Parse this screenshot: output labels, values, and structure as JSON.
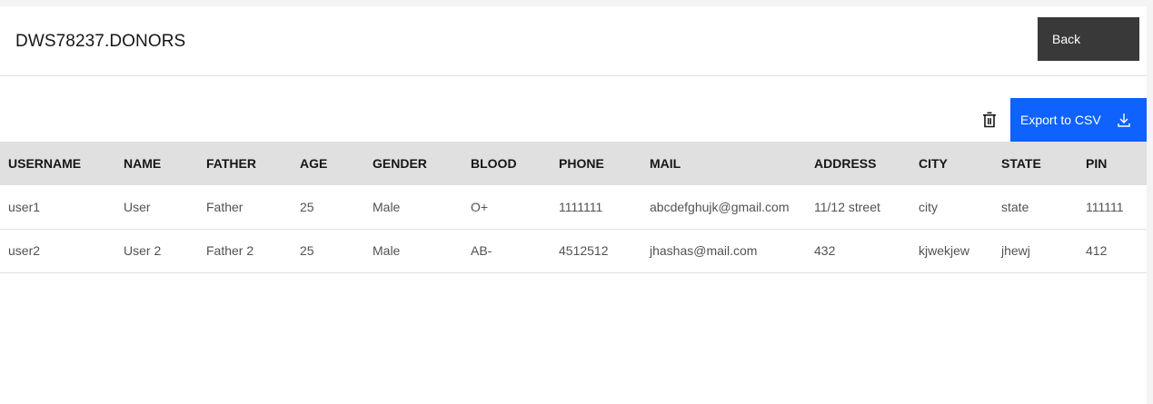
{
  "header": {
    "title": "DWS78237.DONORS",
    "back_label": "Back"
  },
  "toolbar": {
    "delete_icon": "trash-icon",
    "export_label": "Export to CSV",
    "export_icon": "download-icon"
  },
  "colors": {
    "primary": "#0f62fe",
    "back_button": "#393939",
    "header_row": "#e0e0e0"
  },
  "table": {
    "columns": [
      "USERNAME",
      "NAME",
      "FATHER",
      "AGE",
      "GENDER",
      "BLOOD",
      "PHONE",
      "MAIL",
      "ADDRESS",
      "CITY",
      "STATE",
      "PIN"
    ],
    "rows": [
      [
        "user1",
        "User",
        "Father",
        "25",
        "Male",
        "O+",
        "1111111",
        "abcdefghujk@gmail.com",
        "11/12 street",
        "city",
        "state",
        "111111"
      ],
      [
        "user2",
        "User 2",
        "Father 2",
        "25",
        "Male",
        "AB-",
        "4512512",
        "jhashas@mail.com",
        "432",
        "kjwekjew",
        "jhewj",
        "412"
      ]
    ]
  }
}
